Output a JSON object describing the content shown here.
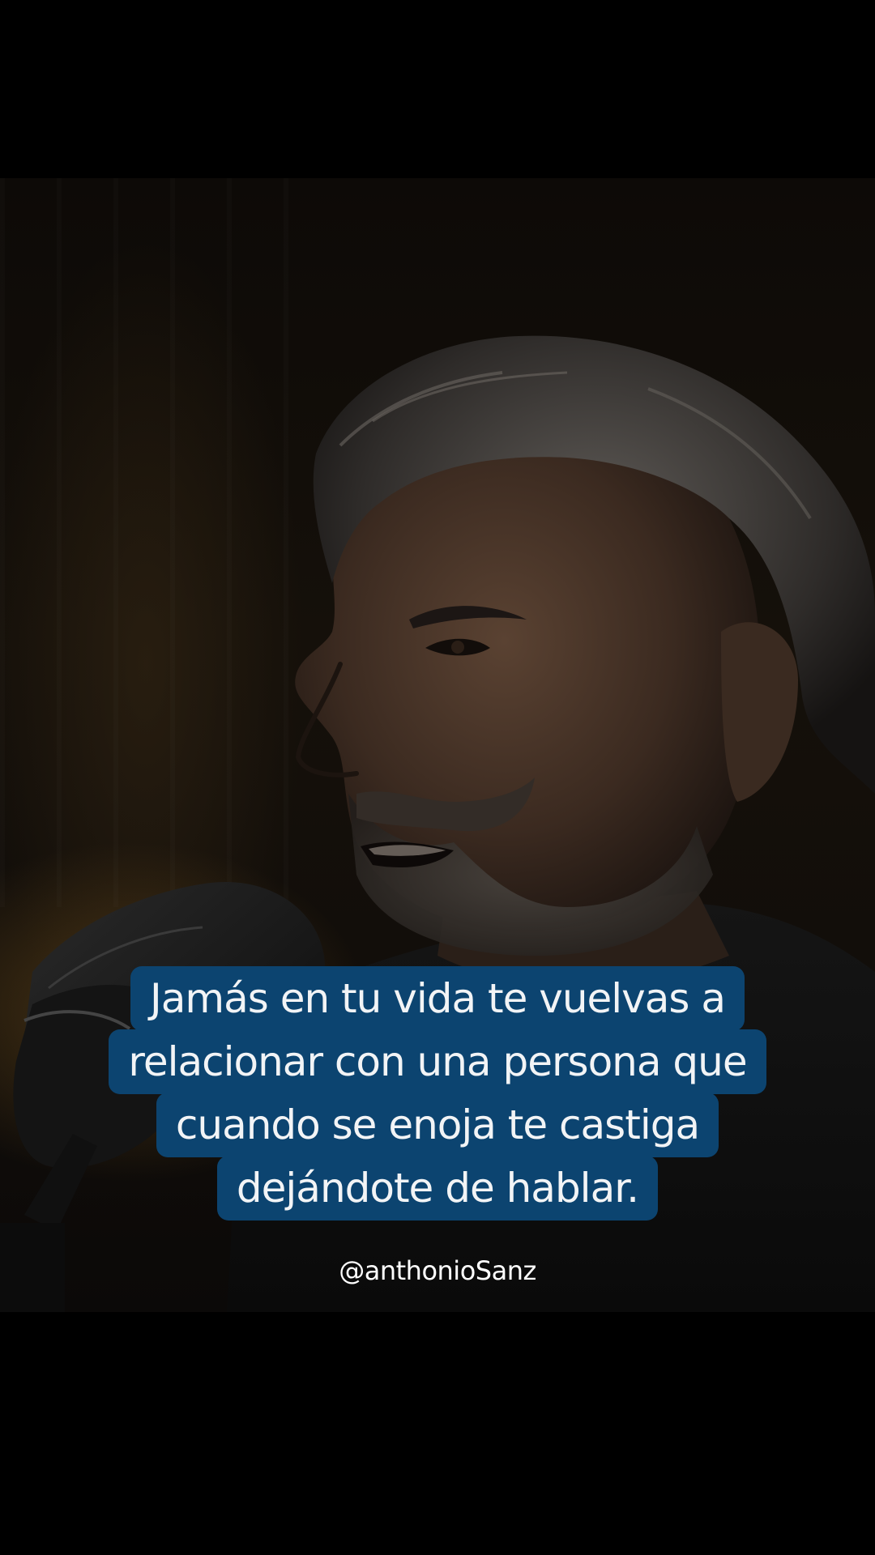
{
  "caption": {
    "lines": [
      "Jamás en tu vida te vuelvas a",
      "relacionar con una persona que",
      "cuando se enoja te castiga",
      "dejándote de hablar."
    ]
  },
  "watermark": {
    "handle": "@anthonioSanz"
  },
  "colors": {
    "background": "#000000",
    "caption_box": "#0c4470",
    "caption_text": "#f2f4f6",
    "handle_text": "#ffffff"
  }
}
